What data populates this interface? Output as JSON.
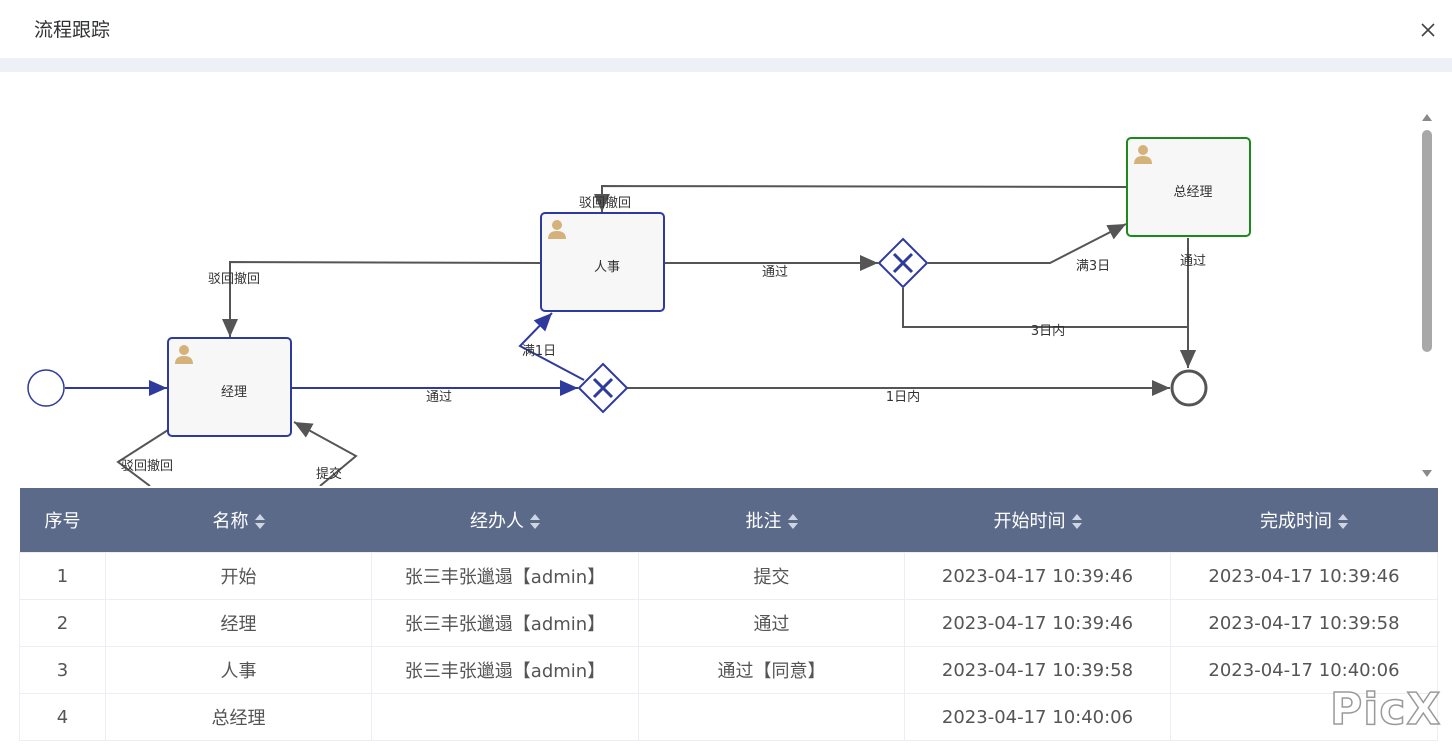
{
  "dialog": {
    "title": "流程跟踪"
  },
  "diagram": {
    "nodes": {
      "manager": "经理",
      "hr": "人事",
      "general_manager": "总经理"
    },
    "edges": {
      "manager_pass": "通过",
      "manager_reject": "驳回撤回",
      "manager_submit": "提交",
      "hr_reject": "驳回撤回",
      "hr_pass": "通过",
      "gm_reject": "驳回撤回",
      "gm_pass": "通过",
      "gw1_full": "满1日",
      "gw1_within": "1日内",
      "gw2_full": "满3日",
      "gw2_within": "3日内"
    },
    "colors": {
      "active": "#2e3a9e",
      "current": "#1a8a1a",
      "idle": "#555555",
      "task_fill": "#f7f7f7",
      "user_icon": "#d4b27a"
    }
  },
  "table": {
    "columns": [
      "序号",
      "名称",
      "经办人",
      "批注",
      "开始时间",
      "完成时间"
    ],
    "rows": [
      [
        "1",
        "开始",
        "张三丰张邋遢【admin】",
        "提交",
        "2023-04-17 10:39:46",
        "2023-04-17 10:39:46"
      ],
      [
        "2",
        "经理",
        "张三丰张邋遢【admin】",
        "通过",
        "2023-04-17 10:39:46",
        "2023-04-17 10:39:58"
      ],
      [
        "3",
        "人事",
        "张三丰张邋遢【admin】",
        "通过【同意】",
        "2023-04-17 10:39:58",
        "2023-04-17 10:40:06"
      ],
      [
        "4",
        "总经理",
        "",
        "",
        "2023-04-17 10:40:06",
        ""
      ]
    ]
  },
  "watermark": "PicX"
}
